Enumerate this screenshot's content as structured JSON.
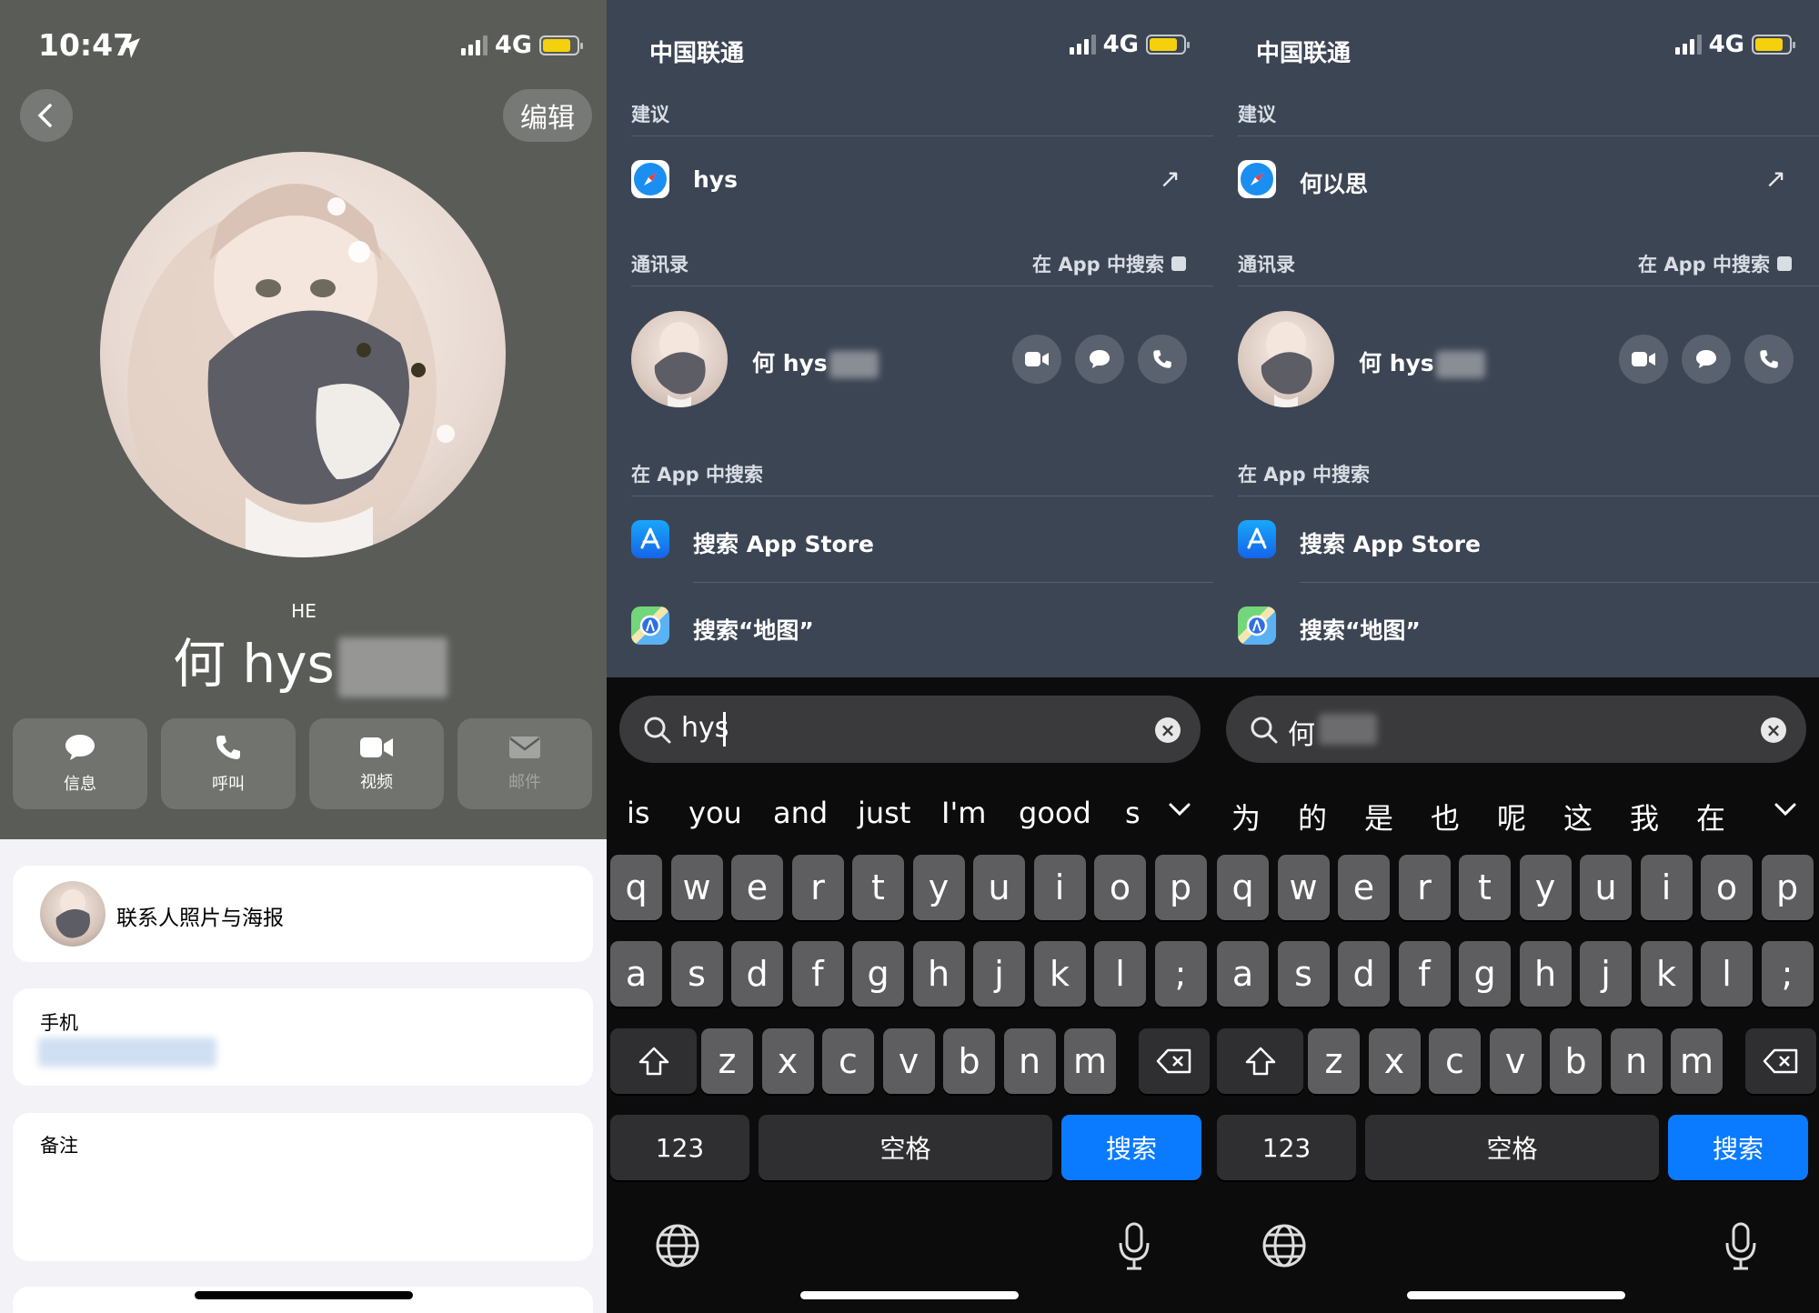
{
  "panel1": {
    "status": {
      "time": "10:47",
      "network": "4G"
    },
    "edit_label": "编辑",
    "contact": {
      "phonetic": "HE",
      "name": "何 hys"
    },
    "actions": [
      {
        "label": "信息",
        "icon": "message-icon",
        "enabled": true
      },
      {
        "label": "呼叫",
        "icon": "phone-icon",
        "enabled": true
      },
      {
        "label": "视频",
        "icon": "video-icon",
        "enabled": true
      },
      {
        "label": "邮件",
        "icon": "mail-icon",
        "enabled": false
      }
    ],
    "poster_label": "联系人照片与海报",
    "phone_label": "手机",
    "notes_label": "备注"
  },
  "panel2": {
    "carrier": "中国联通",
    "network": "4G",
    "suggestions_header": "建议",
    "suggestion": "hys",
    "contacts_header": "通讯录",
    "search_in_app": "在 App 中搜索",
    "contact_name": "何 hys",
    "in_app_header": "在 App 中搜索",
    "app_store": "搜索 App Store",
    "maps": "搜索“地图”",
    "search_value": "hys",
    "candidates": [
      "is",
      "you",
      "and",
      "just",
      "I'm",
      "good",
      "s"
    ]
  },
  "panel3": {
    "carrier": "中国联通",
    "network": "4G",
    "suggestions_header": "建议",
    "suggestion": "何以思",
    "contacts_header": "通讯录",
    "search_in_app": "在 App 中搜索",
    "contact_name": "何 hys",
    "in_app_header": "在 App 中搜索",
    "app_store": "搜索 App Store",
    "maps": "搜索“地图”",
    "search_value": "何",
    "candidates": [
      "为",
      "的",
      "是",
      "也",
      "呢",
      "这",
      "我",
      "在"
    ]
  },
  "keyboard": {
    "row1": [
      "q",
      "w",
      "e",
      "r",
      "t",
      "y",
      "u",
      "i",
      "o",
      "p"
    ],
    "row2": [
      "a",
      "s",
      "d",
      "f",
      "g",
      "h",
      "j",
      "k",
      "l",
      ";"
    ],
    "row3": [
      "z",
      "x",
      "c",
      "v",
      "b",
      "n",
      "m"
    ],
    "numbers": "123",
    "space": "空格",
    "search": "搜索"
  },
  "colors": {
    "accent": "#0a7aff",
    "battery": "#f5d10d",
    "search_bg": "#3c4554"
  }
}
